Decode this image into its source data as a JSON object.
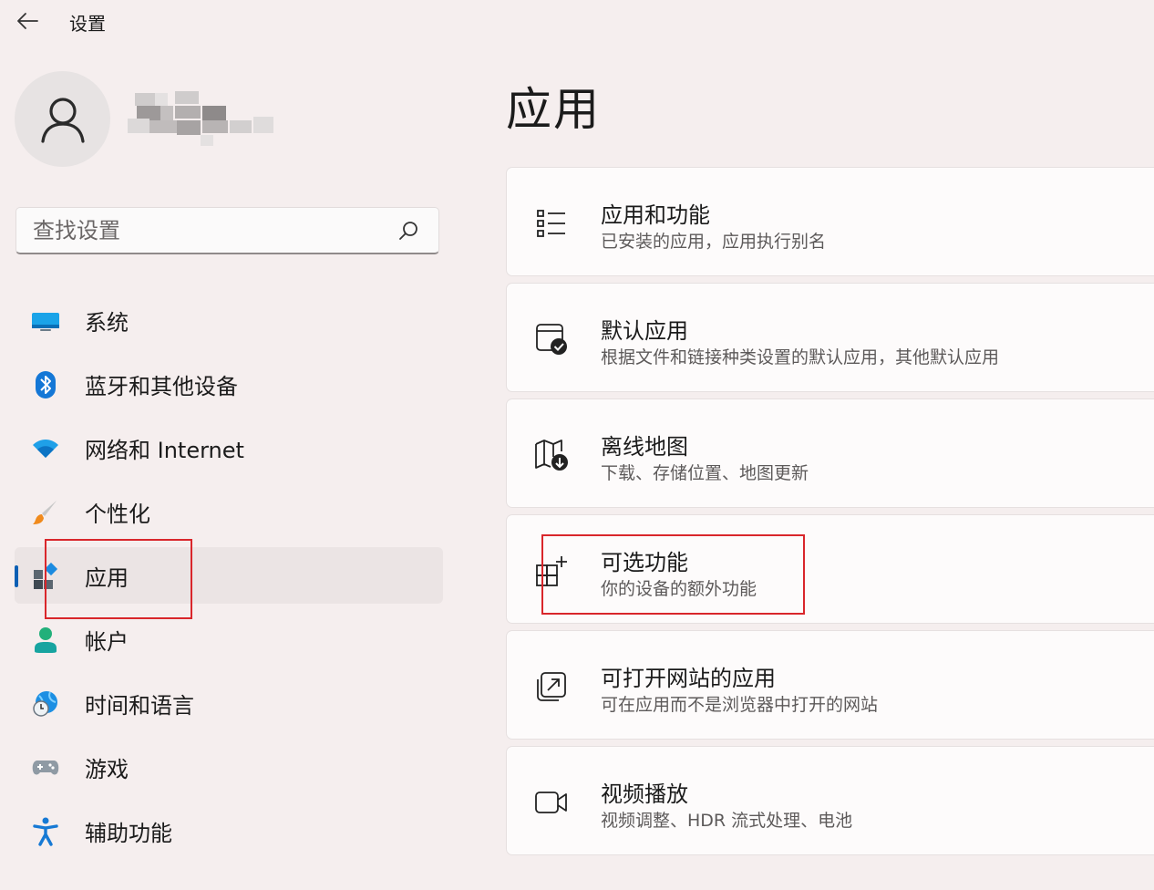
{
  "window": {
    "title": "设置",
    "back_icon": "arrow-left-icon"
  },
  "user": {
    "avatar_icon": "person-icon",
    "name": ""
  },
  "search": {
    "placeholder": "查找设置",
    "icon": "search-icon"
  },
  "sidebar": {
    "items": [
      {
        "label": "系统",
        "icon": "monitor-icon",
        "selected": false
      },
      {
        "label": "蓝牙和其他设备",
        "icon": "bluetooth-icon",
        "selected": false
      },
      {
        "label": "网络和 Internet",
        "icon": "wifi-icon",
        "selected": false
      },
      {
        "label": "个性化",
        "icon": "paintbrush-icon",
        "selected": false
      },
      {
        "label": "应用",
        "icon": "apps-icon",
        "selected": true
      },
      {
        "label": "帐户",
        "icon": "account-icon",
        "selected": false
      },
      {
        "label": "时间和语言",
        "icon": "globe-clock-icon",
        "selected": false
      },
      {
        "label": "游戏",
        "icon": "gamepad-icon",
        "selected": false
      },
      {
        "label": "辅助功能",
        "icon": "accessibility-icon",
        "selected": false
      }
    ]
  },
  "main": {
    "title": "应用",
    "cards": [
      {
        "title": "应用和功能",
        "subtitle": "已安装的应用，应用执行别名",
        "icon": "list-icon"
      },
      {
        "title": "默认应用",
        "subtitle": "根据文件和链接种类设置的默认应用，其他默认应用",
        "icon": "default-app-check-icon"
      },
      {
        "title": "离线地图",
        "subtitle": "下载、存储位置、地图更新",
        "icon": "map-download-icon"
      },
      {
        "title": "可选功能",
        "subtitle": "你的设备的额外功能",
        "icon": "grid-add-icon"
      },
      {
        "title": "可打开网站的应用",
        "subtitle": "可在应用而不是浏览器中打开的网站",
        "icon": "open-external-icon"
      },
      {
        "title": "视频播放",
        "subtitle": "视频调整、HDR 流式处理、电池",
        "icon": "video-camera-icon"
      }
    ]
  },
  "colors": {
    "accent": "#0a5fb4",
    "highlight": "#d9262b",
    "background": "#f5eeee"
  }
}
